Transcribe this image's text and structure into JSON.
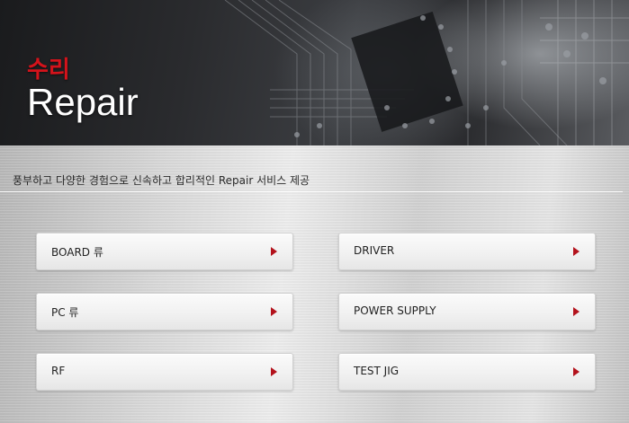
{
  "header": {
    "title_ko": "수리",
    "title_en": "Repair"
  },
  "intro": {
    "text": "풍부하고 다양한 경험으로 신속하고 합리적인 Repair 서비스 제공"
  },
  "menu": {
    "items": [
      {
        "label": "BOARD 류"
      },
      {
        "label": "DRIVER"
      },
      {
        "label": "PC 류"
      },
      {
        "label": "POWER SUPPLY"
      },
      {
        "label": "RF"
      },
      {
        "label": "TEST JIG"
      }
    ]
  },
  "colors": {
    "accent_red": "#d4131b",
    "arrow_red": "#b3121c"
  },
  "icons": {
    "arrow": "arrow-right-icon"
  }
}
